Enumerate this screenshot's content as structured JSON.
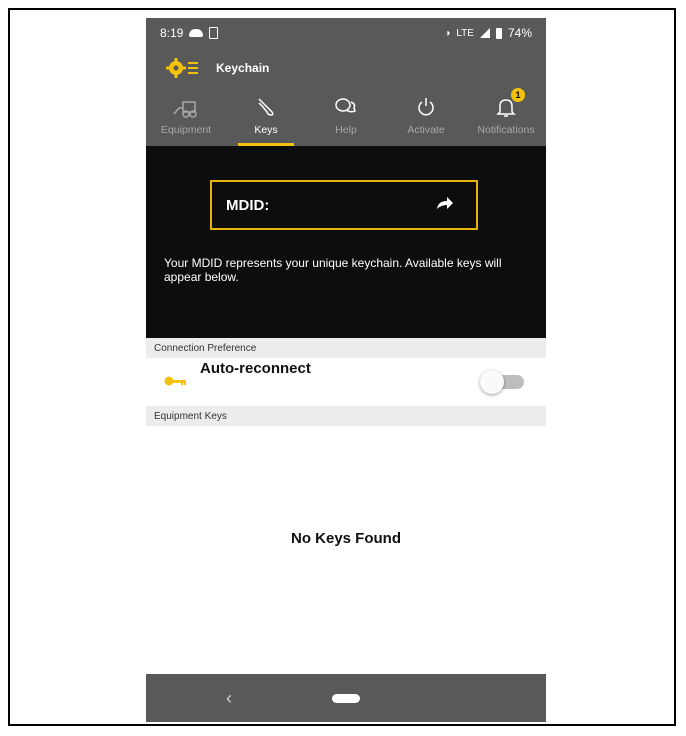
{
  "status_bar": {
    "time": "8:19",
    "network": "LTE",
    "battery": "74%"
  },
  "app": {
    "title": "Keychain"
  },
  "tabs": [
    {
      "label": "Equipment",
      "icon": "equipment-icon"
    },
    {
      "label": "Keys",
      "icon": "keys-icon",
      "active": true
    },
    {
      "label": "Help",
      "icon": "help-icon"
    },
    {
      "label": "Activate",
      "icon": "power-icon"
    },
    {
      "label": "Notifications",
      "icon": "bell-icon",
      "badge": "1"
    }
  ],
  "hero": {
    "mdid_label": "MDID:",
    "description": "Your MDID represents your unique keychain.  Available keys will appear below."
  },
  "connection_preference": {
    "header": "Connection Preference",
    "auto_reconnect_label": "Auto-reconnect",
    "auto_reconnect_enabled": false
  },
  "equipment_keys": {
    "header": "Equipment Keys",
    "empty_message": "No Keys Found"
  },
  "colors": {
    "accent": "#f4c20d",
    "header_bg": "#595959",
    "hero_bg": "#0d0d0d"
  }
}
